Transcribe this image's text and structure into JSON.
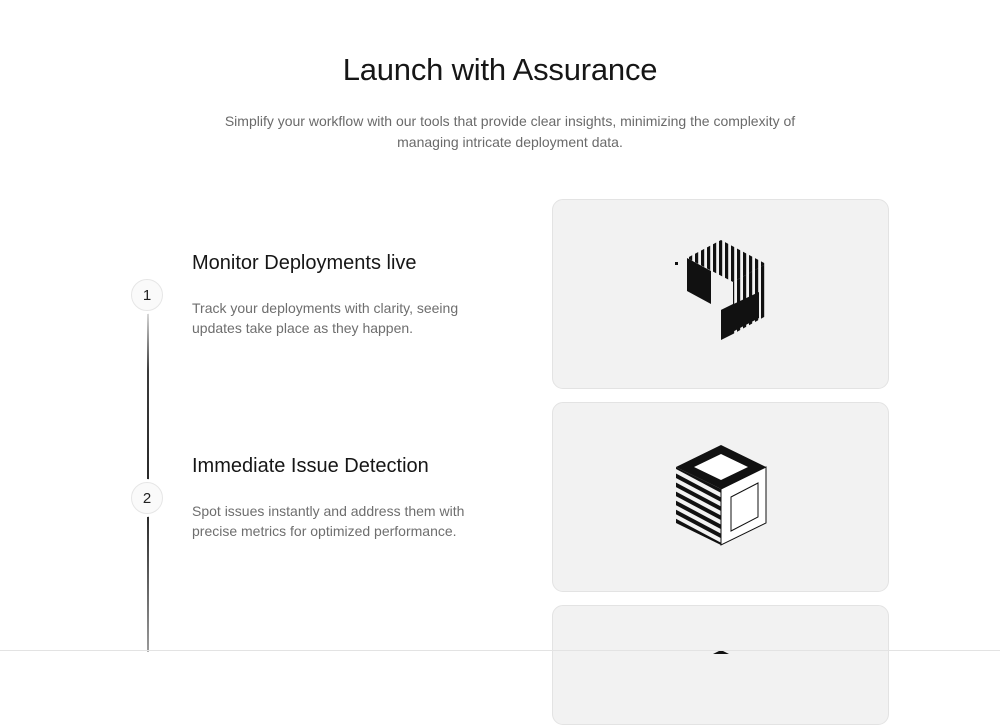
{
  "header": {
    "title": "Launch with Assurance",
    "subtitle": "Simplify your workflow with our tools that provide clear insights, minimizing the complexity of managing intricate deployment data."
  },
  "steps": [
    {
      "number": "1",
      "title": "Monitor Deployments live",
      "description": "Track your deployments with clarity, seeing updates take place as they happen.",
      "illustration_icon": "striped-cube-shell-icon"
    },
    {
      "number": "2",
      "title": "Immediate Issue Detection",
      "description": "Spot issues instantly and address them with precise metrics for optimized performance.",
      "illustration_icon": "open-cube-icon"
    },
    {
      "illustration_icon": "stacked-layers-icon"
    }
  ],
  "colors": {
    "background": "#ffffff",
    "card_background": "#f2f2f2",
    "text_primary": "#161616",
    "text_secondary": "#6e6e6e"
  }
}
